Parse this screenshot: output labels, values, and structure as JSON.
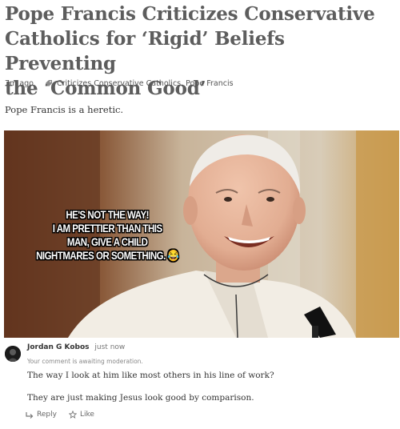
{
  "article": {
    "title_lines": [
      "Pope Francis Criticizes Conservative",
      "Catholics for ‘Rigid’ Beliefs Preventing",
      "the ‘Common Good’"
    ],
    "time_ago": "7m ago",
    "tags_icon": "tag-icon",
    "tags": "Criticizes Conservative Catholics, Pope Francis",
    "intro": "Pope Francis is a heretic."
  },
  "image": {
    "meme_lines": [
      "HE'S NOT THE WAY!",
      "I AM PRETTIER THAN THIS",
      "MAN, GIVE A CHILD",
      "NIGHTMARES OR SOMETHING. 😂"
    ],
    "colors": {
      "background": "#c9b59c",
      "skin": "#e6b79d",
      "robe": "#f2ede4"
    }
  },
  "comment": {
    "author": "Jordan G Kobos",
    "time": "just now",
    "moderation": "Your comment is awaiting moderation.",
    "paragraphs": [
      "The way I look at him like most others in his line of work?",
      "They are just making Jesus look good by comparison."
    ],
    "reply_label": "Reply",
    "reply_icon": "reply-icon",
    "like_label": "Like",
    "like_icon": "star-icon"
  }
}
